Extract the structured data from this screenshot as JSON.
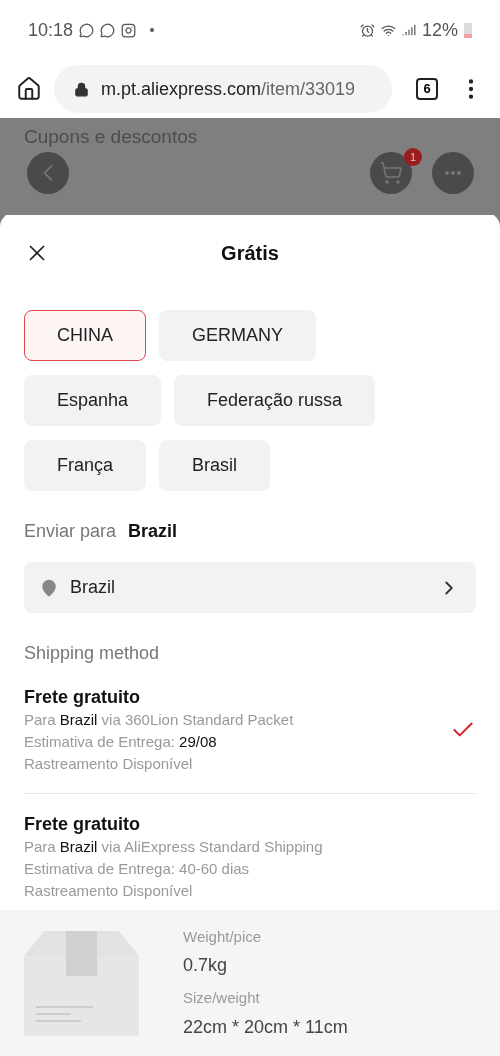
{
  "status_bar": {
    "time": "10:18",
    "battery": "12%"
  },
  "browser": {
    "domain": "m.pt.aliexpress.com",
    "path": "/item/33019",
    "tab_count": "6"
  },
  "background_page": {
    "heading": "Cupons e descontos",
    "cart_badge": "1"
  },
  "sheet": {
    "title": "Grátis",
    "origins": [
      {
        "label": "CHINA",
        "selected": true
      },
      {
        "label": "GERMANY",
        "selected": false
      },
      {
        "label": "Espanha",
        "selected": false
      },
      {
        "label": "Federação russa",
        "selected": false
      },
      {
        "label": "França",
        "selected": false
      },
      {
        "label": "Brasil",
        "selected": false
      }
    ],
    "ship_to": {
      "label": "Enviar para",
      "value": "Brazil"
    },
    "location": "Brazil",
    "shipping_heading": "Shipping method",
    "options": [
      {
        "title": "Frete gratuito",
        "lines": [
          "Para **Brazil** via 360Lion Standard Packet",
          "Estimativa de Entrega: **29/08**",
          "Rastreamento Disponível"
        ],
        "selected": true
      },
      {
        "title": "Frete gratuito",
        "lines": [
          "Para **Brazil** via AliExpress Standard Shipping",
          "Estimativa de Entrega: 40-60 dias",
          "Rastreamento Disponível"
        ],
        "selected": false
      }
    ],
    "package": {
      "weight_label": "Weight/pice",
      "weight": "0.7kg",
      "size_label": "Size/weight",
      "size": "22cm * 20cm * 11cm"
    }
  }
}
